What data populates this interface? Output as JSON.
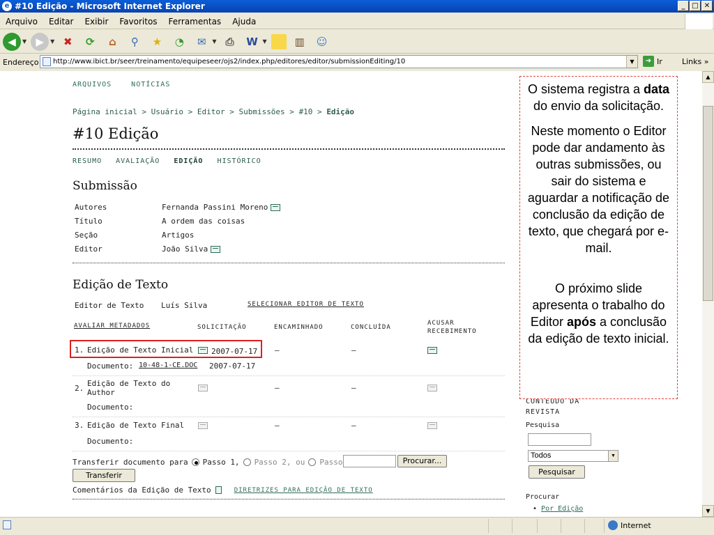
{
  "window": {
    "title": "#10 Edição - Microsoft Internet Explorer",
    "icon_name": "ie-icon"
  },
  "menu": [
    "Arquivo",
    "Editar",
    "Exibir",
    "Favoritos",
    "Ferramentas",
    "Ajuda"
  ],
  "address": {
    "label": "Endereço",
    "url": "http://www.ibict.br/seer/treinamento/equipeseer/ojs2/index.php/editores/editor/submissionEditing/10",
    "go_label": "Ir",
    "links_label": "Links"
  },
  "status": {
    "zone": "Internet"
  },
  "page": {
    "top_nav": [
      "ARQUIVOS",
      "NOTÍCIAS"
    ],
    "breadcrumb": [
      "Página inicial",
      "Usuário",
      "Editor",
      "Submissões",
      "#10"
    ],
    "breadcrumb_current": "Edição",
    "title": "#10 Edição",
    "tabs": [
      "RESUMO",
      "AVALIAÇÃO",
      "EDIÇÃO",
      "HISTÓRICO"
    ],
    "submission": {
      "heading": "Submissão",
      "rows": [
        {
          "key": "Autores",
          "value": "Fernanda Passini Moreno"
        },
        {
          "key": "Título",
          "value": "A ordem das coisas"
        },
        {
          "key": "Seção",
          "value": "Artigos"
        },
        {
          "key": "Editor",
          "value": "João Silva"
        }
      ]
    },
    "copyedit": {
      "heading": "Edição de Texto",
      "editor_label": "Editor de Texto",
      "editor_name": "Luís Silva",
      "select_link": "SELECIONAR EDITOR DE TEXTO",
      "review_metadata_link": "AVALIAR METADADOS",
      "columns": [
        "SOLICITAÇÃO",
        "ENCAMINHADO",
        "CONCLUÍDA",
        "ACUSAR",
        "RECEBIMENTO"
      ],
      "steps": [
        {
          "num": "1.",
          "label": "Edição de Texto Inicial",
          "request_date": "2007-07-17",
          "underway": "—",
          "complete": "—",
          "doc_label": "Documento:",
          "doc_link": "10-48-1-CE.DOC",
          "doc_date": "2007-07-17"
        },
        {
          "num": "2.",
          "label_line1": "Edição de Texto do",
          "label_line2": "Author",
          "underway": "—",
          "complete": "—",
          "doc_label": "Documento:"
        },
        {
          "num": "3.",
          "label": "Edição de Texto Final",
          "underway": "—",
          "complete": "—",
          "doc_label": "Documento:"
        }
      ],
      "transfer": {
        "label": "Transferir documento para",
        "step1": "Passo 1,",
        "step2": "Passo 2, ou",
        "step3": "Passo 3",
        "browse_label": "Procurar...",
        "submit_label": "Transferir"
      },
      "comments_label": "Comentários da Edição de Texto",
      "guidelines_link": "DIRETRIZES PARA EDIÇÃO DE TEXTO"
    },
    "sidebar": {
      "content_line1": "CONTEÚDO DA",
      "content_line2": "REVISTA",
      "search_label": "Pesquisa",
      "search_scope": "Todos",
      "search_button": "Pesquisar",
      "browse_label": "Procurar",
      "browse_item": "Por Edição"
    }
  },
  "callout": {
    "p1_before": "O sistema registra a",
    "p1_bold": "data",
    "p1_after": "do envio da solicitação.",
    "p2": "Neste momento o Editor pode dar andamento às outras submissões, ou sair do sistema e aguardar a notificação de conclusão da edição de texto, que chegará por e-mail.",
    "p3_before": "O próximo slide apresenta o trabalho do Editor",
    "p3_bold": "após",
    "p3_after": "a conclusão da edição de texto inicial."
  }
}
